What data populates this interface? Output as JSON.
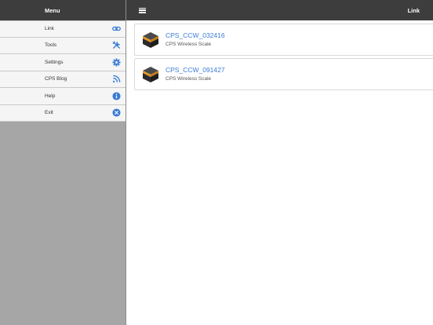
{
  "sidebar": {
    "title": "Menu",
    "items": [
      {
        "label": "Link",
        "icon": "link-icon"
      },
      {
        "label": "Tools",
        "icon": "tools-icon"
      },
      {
        "label": "Settings",
        "icon": "gear-icon"
      },
      {
        "label": "CPS Blog",
        "icon": "rss-icon"
      },
      {
        "label": "Help",
        "icon": "info-icon"
      },
      {
        "label": "Exit",
        "icon": "close-icon"
      }
    ]
  },
  "header": {
    "menu_icon": "hamburger-icon",
    "title": "Link"
  },
  "devices": [
    {
      "name": "CPS_CCW_032416",
      "type": "CPS Wireless Scale",
      "icon": "scale-icon"
    },
    {
      "name": "CPS_CCW_091427",
      "type": "CPS Wireless Scale",
      "icon": "scale-icon"
    }
  ],
  "colors": {
    "accent": "#3a7bd5",
    "header_bg": "#3d3d3d",
    "sidebar_bg": "#a6a6a6",
    "menu_bg": "#f5f5f5"
  }
}
